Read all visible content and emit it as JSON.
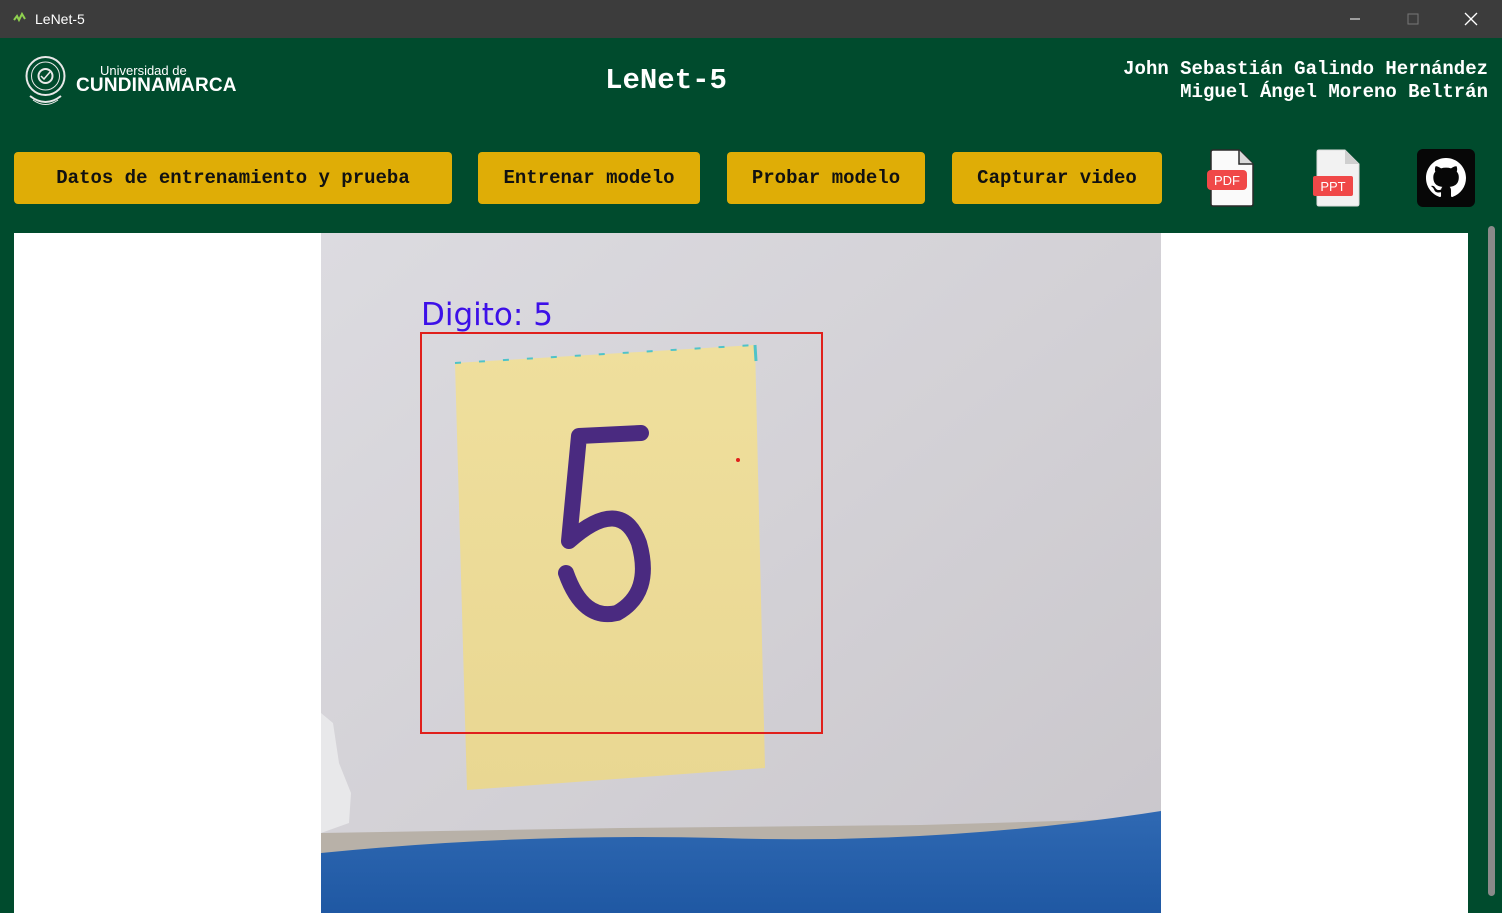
{
  "window": {
    "title": "LeNet-5",
    "minimize_icon": "minimize-icon",
    "maximize_icon": "maximize-icon",
    "close_icon": "close-icon"
  },
  "header": {
    "logo_line1": "Universidad de",
    "logo_line2": "CUNDINAMARCA",
    "title": "LeNet-5",
    "author1": "John Sebastián Galindo Hernández",
    "author2": "Miguel Ángel Moreno Beltrán"
  },
  "toolbar": {
    "buttons": [
      {
        "label": "Datos de entrenamiento y prueba"
      },
      {
        "label": "Entrenar modelo"
      },
      {
        "label": "Probar modelo"
      },
      {
        "label": "Capturar video"
      }
    ],
    "pdf_label": "PDF",
    "ppt_label": "PPT",
    "github_icon": "github-icon"
  },
  "video": {
    "prediction_label": "Digito: 5",
    "handwritten_digit": "5"
  },
  "colors": {
    "header_bg": "#004b2d",
    "button_bg": "#dfad06",
    "titlebar_bg": "#3c3c3c",
    "detection_box": "#e0201c",
    "label_color": "#3d10e8"
  }
}
